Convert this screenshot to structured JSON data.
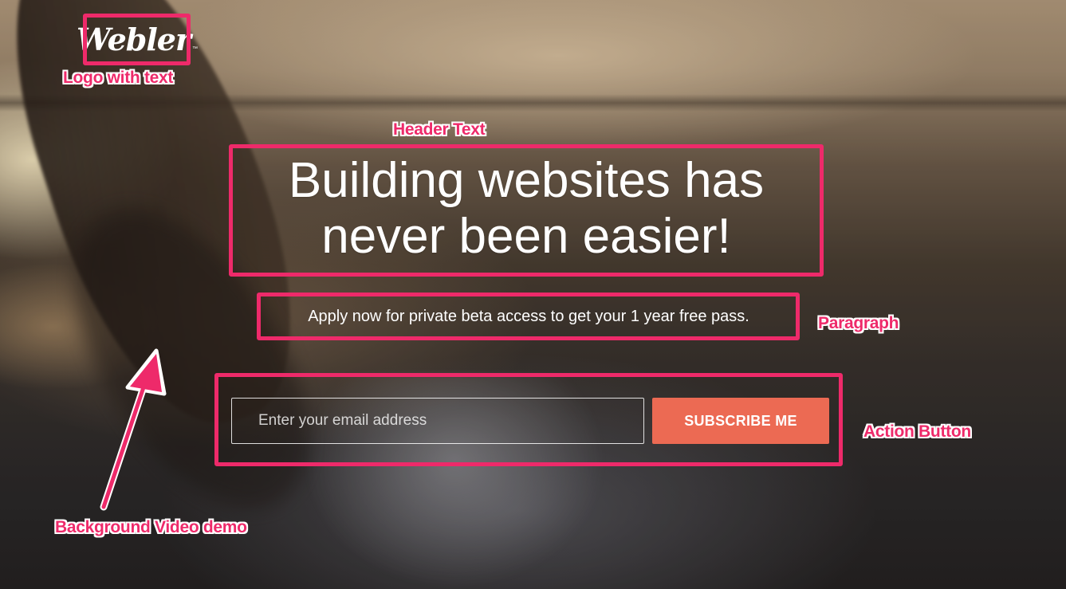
{
  "brand": {
    "logo_text": "Webler",
    "trademark": "™"
  },
  "hero": {
    "headline_line1": "Building websites has",
    "headline_line2": "never been easier!",
    "paragraph": "Apply now for private beta access to get your 1 year free pass."
  },
  "form": {
    "email_placeholder": "Enter your email address",
    "email_value": "",
    "subscribe_label": "SUBSCRIBE ME"
  },
  "annotations": {
    "logo": "Logo with text",
    "header": "Header Text",
    "paragraph": "Paragraph",
    "action": "Action Button",
    "background": "Background Video demo"
  },
  "colors": {
    "annotation": "#ee2a6a",
    "button": "#ec6a53",
    "text": "#ffffff"
  },
  "icons": {
    "annotation_arrow": "arrow-up-icon"
  }
}
